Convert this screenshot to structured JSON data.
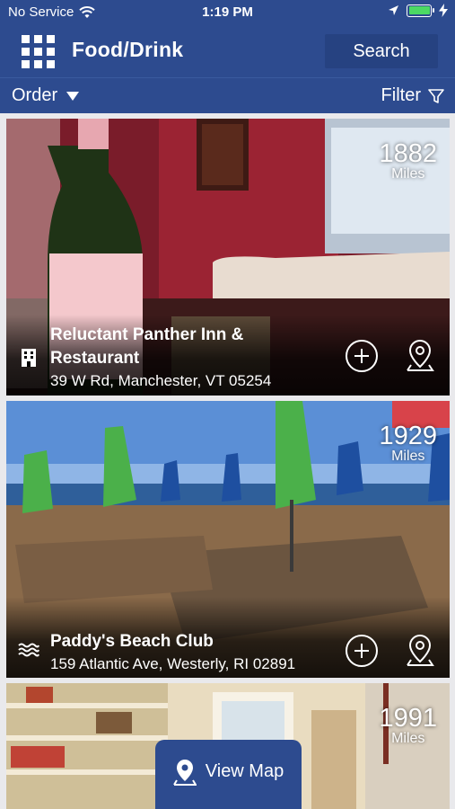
{
  "status_bar": {
    "carrier": "No Service",
    "time": "1:19 PM"
  },
  "header": {
    "title": "Food/Drink",
    "search_label": "Search"
  },
  "toolbar": {
    "order_label": "Order",
    "filter_label": "Filter"
  },
  "listings": [
    {
      "name": "Reluctant Panther Inn & Restaurant",
      "address": "39 W Rd, Manchester, VT 05254",
      "distance": "1882",
      "distance_unit": "Miles",
      "category_icon": "building-icon"
    },
    {
      "name": "Paddy's Beach Club",
      "address": "159 Atlantic Ave, Westerly, RI 02891",
      "distance": "1929",
      "distance_unit": "Miles",
      "category_icon": "waves-icon"
    },
    {
      "name": "",
      "address": "",
      "distance": "1991",
      "distance_unit": "Miles",
      "category_icon": ""
    }
  ],
  "map_button": {
    "label": "View Map"
  },
  "colors": {
    "brand": "#2d4b8f",
    "search_button": "#264281",
    "battery": "#4cd964"
  }
}
